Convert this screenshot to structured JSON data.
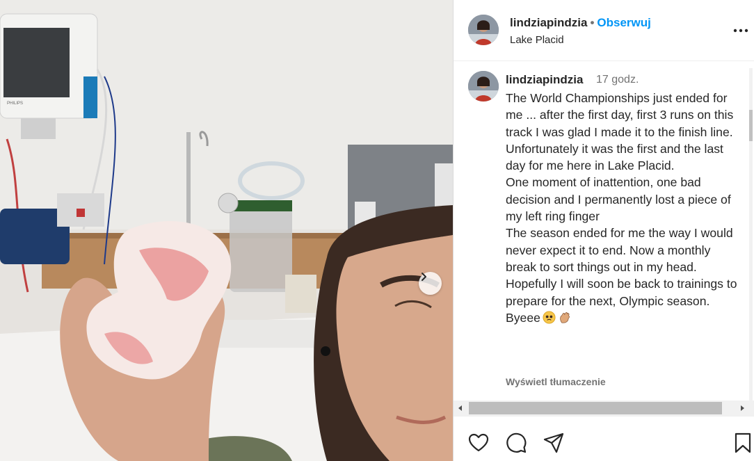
{
  "post": {
    "username": "lindziapindzia",
    "follow_label": "Obserwuj",
    "separator": "•",
    "location": "Lake Placid"
  },
  "caption": {
    "username": "lindziapindzia",
    "time_ago": "17 godz.",
    "text": "The World Championships just ended for me ... after the first day, first 3 runs on this track I was glad I made it to the finish line. Unfortunately it was the first and the last day for me here in Lake Placid.\nOne moment of inattention, one bad decision and I permanently lost a piece of my left ring finger\nThe season ended for me the way I would never expect it to end. Now a monthly break to sort things out in my head.\nHopefully I will soon be back to trainings to prepare for the next, Olympic season.\nByeee",
    "emojis": [
      "pleading-face-emoji",
      "waving-hand-emoji"
    ],
    "translate_label": "Wyświetl tłumaczenie"
  },
  "photo": {
    "monitor_brand": "PHILIPS",
    "description_icon": "hospital-selfie-photo"
  },
  "icons": {
    "like": "heart-icon",
    "comment": "comment-icon",
    "share": "paper-plane-icon",
    "save": "bookmark-icon",
    "more": "more-options-icon",
    "next": "chevron-right-icon"
  },
  "colors": {
    "accent": "#0095f6",
    "text": "#262626",
    "muted": "#737373",
    "divider": "#dbdbdb"
  }
}
